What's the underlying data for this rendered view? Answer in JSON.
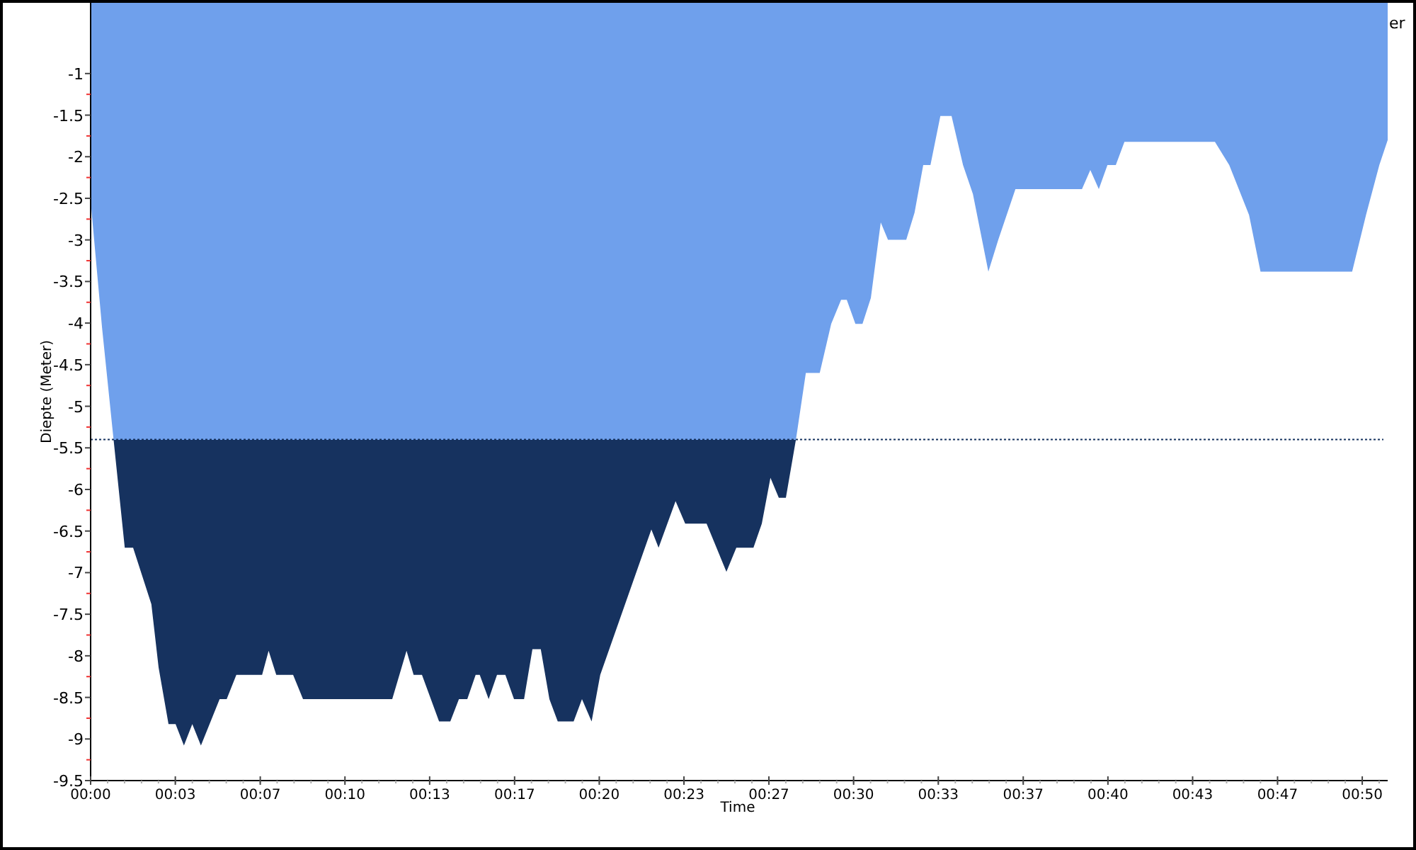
{
  "chart": {
    "legend_fragment": "er",
    "chart_data": {
      "type": "area",
      "xlabel": "Time",
      "ylabel": "Diepte (Meter)",
      "xlim": [
        0,
        51
      ],
      "ylim": [
        -9.5,
        -0.15
      ],
      "x": [
        0,
        0.45,
        0.9,
        1.34,
        1.67,
        2.39,
        2.67,
        3.06,
        3.34,
        3.67,
        4.0,
        4.34,
        5.07,
        5.35,
        5.73,
        6.74,
        7.0,
        7.3,
        7.96,
        8.35,
        11.86,
        12.42,
        12.7,
        13.03,
        13.7,
        14.14,
        14.48,
        14.81,
        15.14,
        15.3,
        15.65,
        15.98,
        16.31,
        16.65,
        17.04,
        17.37,
        17.7,
        18.04,
        18.37,
        18.99,
        19.32,
        19.7,
        20.04,
        22.05,
        22.33,
        23.0,
        23.38,
        24.22,
        25.0,
        25.39,
        26.06,
        26.39,
        26.73,
        27.06,
        27.34,
        27.73,
        28.12,
        28.67,
        29.12,
        29.51,
        29.73,
        30.07,
        30.35,
        30.68,
        31.07,
        31.35,
        32.07,
        32.4,
        32.74,
        33.02,
        33.41,
        33.85,
        34.3,
        34.69,
        35.3,
        35.69,
        36.36,
        38.98,
        39.31,
        39.64,
        39.98,
        40.31,
        40.65,
        44.21,
        44.77,
        45.55,
        46.0,
        49.6,
        50.15,
        50.67,
        51.0
      ],
      "series": [
        {
          "color": "#6fa0ec",
          "values": [
            -2.53,
            -4.06,
            -5.4,
            -6.7,
            -6.7,
            -7.38,
            -8.14,
            -8.82,
            -8.82,
            -9.08,
            -8.82,
            -9.08,
            -8.52,
            -8.52,
            -8.23,
            -8.23,
            -7.94,
            -8.23,
            -8.23,
            -8.52,
            -8.52,
            -7.94,
            -8.23,
            -8.23,
            -8.79,
            -8.79,
            -8.52,
            -8.52,
            -8.23,
            -8.23,
            -8.52,
            -8.23,
            -8.23,
            -8.52,
            -8.52,
            -7.92,
            -7.92,
            -8.52,
            -8.79,
            -8.79,
            -8.52,
            -8.79,
            -8.23,
            -6.48,
            -6.7,
            -6.14,
            -6.41,
            -6.41,
            -6.99,
            -6.7,
            -6.7,
            -6.41,
            -5.86,
            -6.1,
            -6.1,
            -5.4,
            -4.6,
            -4.6,
            -4.01,
            -3.72,
            -3.72,
            -4.01,
            -4.01,
            -3.7,
            -2.79,
            -3.0,
            -3.0,
            -2.67,
            -2.1,
            -2.1,
            -1.51,
            -1.51,
            -2.1,
            -2.45,
            -3.38,
            -3.0,
            -2.39,
            -2.39,
            -2.16,
            -2.39,
            -2.1,
            -2.1,
            -1.82,
            -1.82,
            -2.1,
            -2.7,
            -3.38,
            -3.38,
            -2.7,
            -2.1,
            -1.8
          ]
        }
      ],
      "xticks": [
        {
          "value": 0,
          "label": "00:00"
        },
        {
          "value": 3.33,
          "label": "00:03"
        },
        {
          "value": 6.67,
          "label": "00:07"
        },
        {
          "value": 10,
          "label": "00:10"
        },
        {
          "value": 13.33,
          "label": "00:13"
        },
        {
          "value": 16.67,
          "label": "00:17"
        },
        {
          "value": 20,
          "label": "00:20"
        },
        {
          "value": 23.33,
          "label": "00:23"
        },
        {
          "value": 26.67,
          "label": "00:27"
        },
        {
          "value": 30,
          "label": "00:30"
        },
        {
          "value": 33.33,
          "label": "00:33"
        },
        {
          "value": 36.67,
          "label": "00:37"
        },
        {
          "value": 40,
          "label": "00:40"
        },
        {
          "value": 43.33,
          "label": "00:43"
        },
        {
          "value": 46.67,
          "label": "00:47"
        },
        {
          "value": 50,
          "label": "00:50"
        }
      ],
      "yticks": [
        -1,
        -1.5,
        -2,
        -2.5,
        -3,
        -3.5,
        -4,
        -4.5,
        -5,
        -5.5,
        -6,
        -6.5,
        -7,
        -7.5,
        -8,
        -8.5,
        -9,
        -9.5
      ],
      "ref_lines": [
        {
          "axis": "y",
          "value": -5.4,
          "color": "#16325f"
        }
      ]
    }
  }
}
